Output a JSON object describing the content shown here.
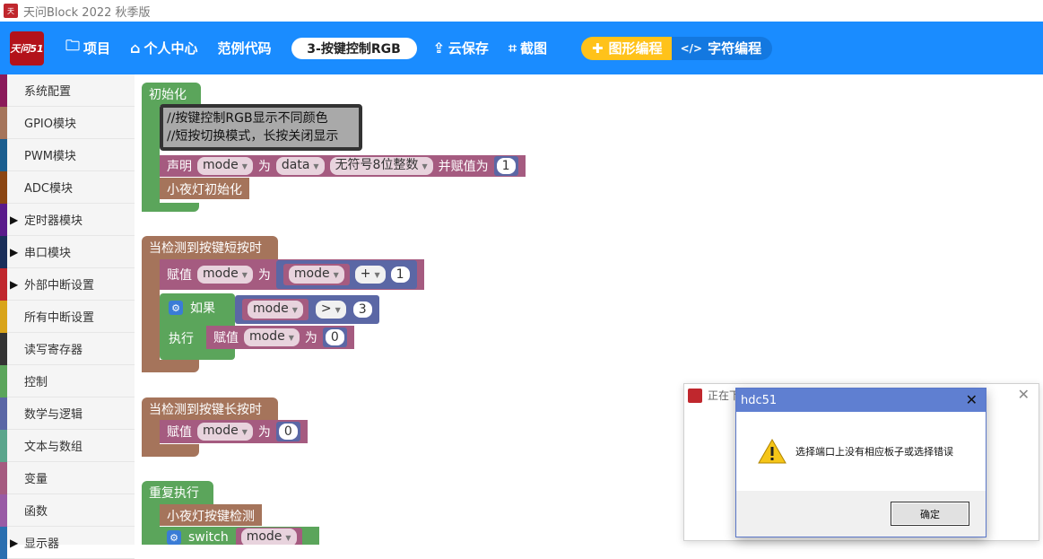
{
  "window": {
    "title": "天问Block 2022 秋季版"
  },
  "toolbar": {
    "logo_text": "天问51",
    "project_label": "项目",
    "personal_center": "个人中心",
    "examples": "范例代码",
    "project_name": "3-按键控制RGB",
    "cloud_save": "云保存",
    "screenshot": "截图",
    "graphic_mode": "图形编程",
    "text_mode": "字符编程"
  },
  "sidebar": {
    "categories": [
      {
        "label": "系统配置",
        "color": "#8b1a5a",
        "arrow": false
      },
      {
        "label": "GPIO模块",
        "color": "#a5745b",
        "arrow": false
      },
      {
        "label": "PWM模块",
        "color": "#1b5e8f",
        "arrow": false
      },
      {
        "label": "ADC模块",
        "color": "#8b4513",
        "arrow": false
      },
      {
        "label": "定时器模块",
        "color": "#5a1a8b",
        "arrow": true
      },
      {
        "label": "串口模块",
        "color": "#1a2e5a",
        "arrow": true
      },
      {
        "label": "外部中断设置",
        "color": "#c0272d",
        "arrow": true
      },
      {
        "label": "所有中断设置",
        "color": "#d9a41a",
        "arrow": false
      },
      {
        "label": "读写寄存器",
        "color": "#333333",
        "arrow": false
      },
      {
        "label": "控制",
        "color": "#5ba55b",
        "arrow": false
      },
      {
        "label": "数学与逻辑",
        "color": "#5b67a5",
        "arrow": false
      },
      {
        "label": "文本与数组",
        "color": "#5ba58c",
        "arrow": false
      },
      {
        "label": "变量",
        "color": "#a55b80",
        "arrow": false
      },
      {
        "label": "函数",
        "color": "#995ba5",
        "arrow": false
      },
      {
        "label": "显示器",
        "color": "#2a6fb0",
        "arrow": true
      }
    ]
  },
  "blocks": {
    "init": {
      "hat": "初始化",
      "comment_line1": "//按键控制RGB显示不同颜色",
      "comment_line2": "//短按切换模式，长按关闭显示",
      "declare": "声明",
      "var_mode": "mode",
      "as": "为",
      "type_data": "data",
      "type_uint8": "无符号8位整数",
      "and_assign": "并赋值为",
      "init_value": "1",
      "light_init": "小夜灯初始化"
    },
    "short_press": {
      "hat": "当检测到按键短按时",
      "assign": "赋值",
      "var": "mode",
      "as": "为",
      "operand_var": "mode",
      "op": "+",
      "operand_value": "1",
      "if_label": "如果",
      "cond_var": "mode",
      "cond_op": ">",
      "cond_value": "3",
      "then_label": "执行",
      "then_assign": "赋值",
      "then_var": "mode",
      "then_as": "为",
      "then_value": "0"
    },
    "long_press": {
      "hat": "当检测到按键长按时",
      "assign": "赋值",
      "var": "mode",
      "as": "为",
      "value": "0"
    },
    "loop": {
      "hat": "重复执行",
      "detect": "小夜灯按键检测",
      "switch_label": "switch",
      "switch_var": "mode"
    }
  },
  "dialog_back": {
    "title": "正在下"
  },
  "dialog": {
    "title": "hdc51",
    "message": "选择端口上没有相应板子或选择错误",
    "ok_button": "确定"
  }
}
